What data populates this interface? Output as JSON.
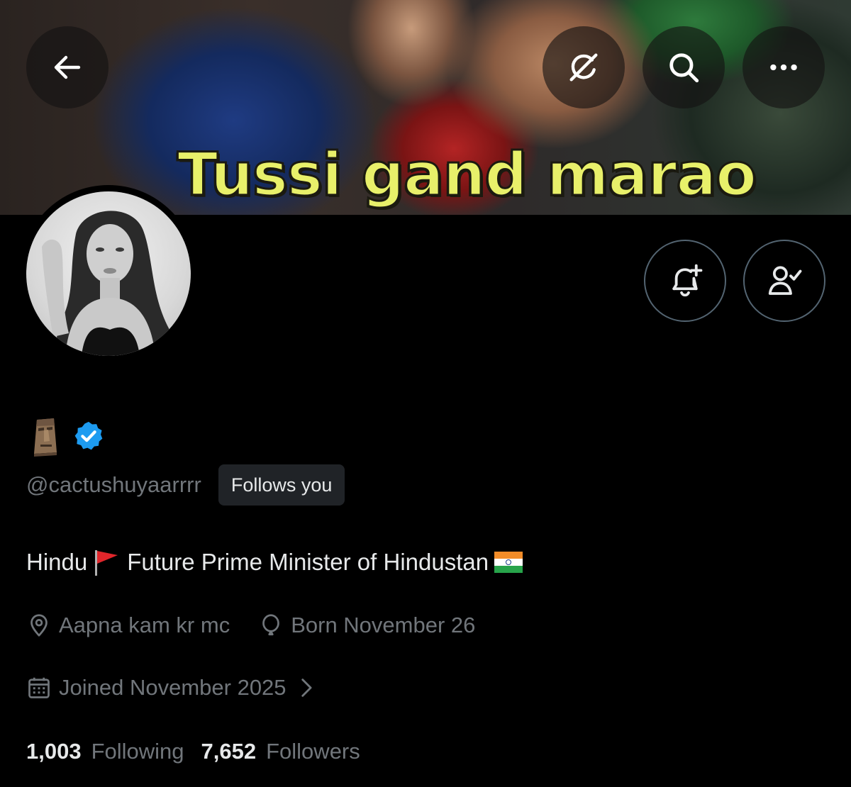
{
  "banner": {
    "caption": "Tussi gand marao"
  },
  "top_bar": {
    "back_icon": "arrow-left-icon",
    "grok_icon": "grok-icon",
    "search_icon": "search-icon",
    "more_icon": "more-horizontal-icon"
  },
  "profile": {
    "display_name_emoji": "moai-emoji",
    "verified_badge": "verified-badge-icon",
    "handle": "@cactushuyaarrrr",
    "follows_you": "Follows you",
    "bio": {
      "part1": "Hindu",
      "part2": "Future Prime Minister of Hindustan"
    },
    "location": "Aapna kam kr mc",
    "birthday": "Born November 26",
    "joined": "Joined November 2025",
    "following_count": "1,003",
    "following_label": "Following",
    "followers_count": "7,652",
    "followers_label": "Followers"
  },
  "actions": {
    "notify_icon": "bell-plus-icon",
    "following_icon": "person-check-icon"
  },
  "colors": {
    "background": "#000000",
    "primary_text": "#e7e9ea",
    "secondary_text": "#71767b",
    "verified_blue": "#1d9bf0",
    "caption_yellow": "#e8f06a",
    "button_border": "#536471"
  }
}
